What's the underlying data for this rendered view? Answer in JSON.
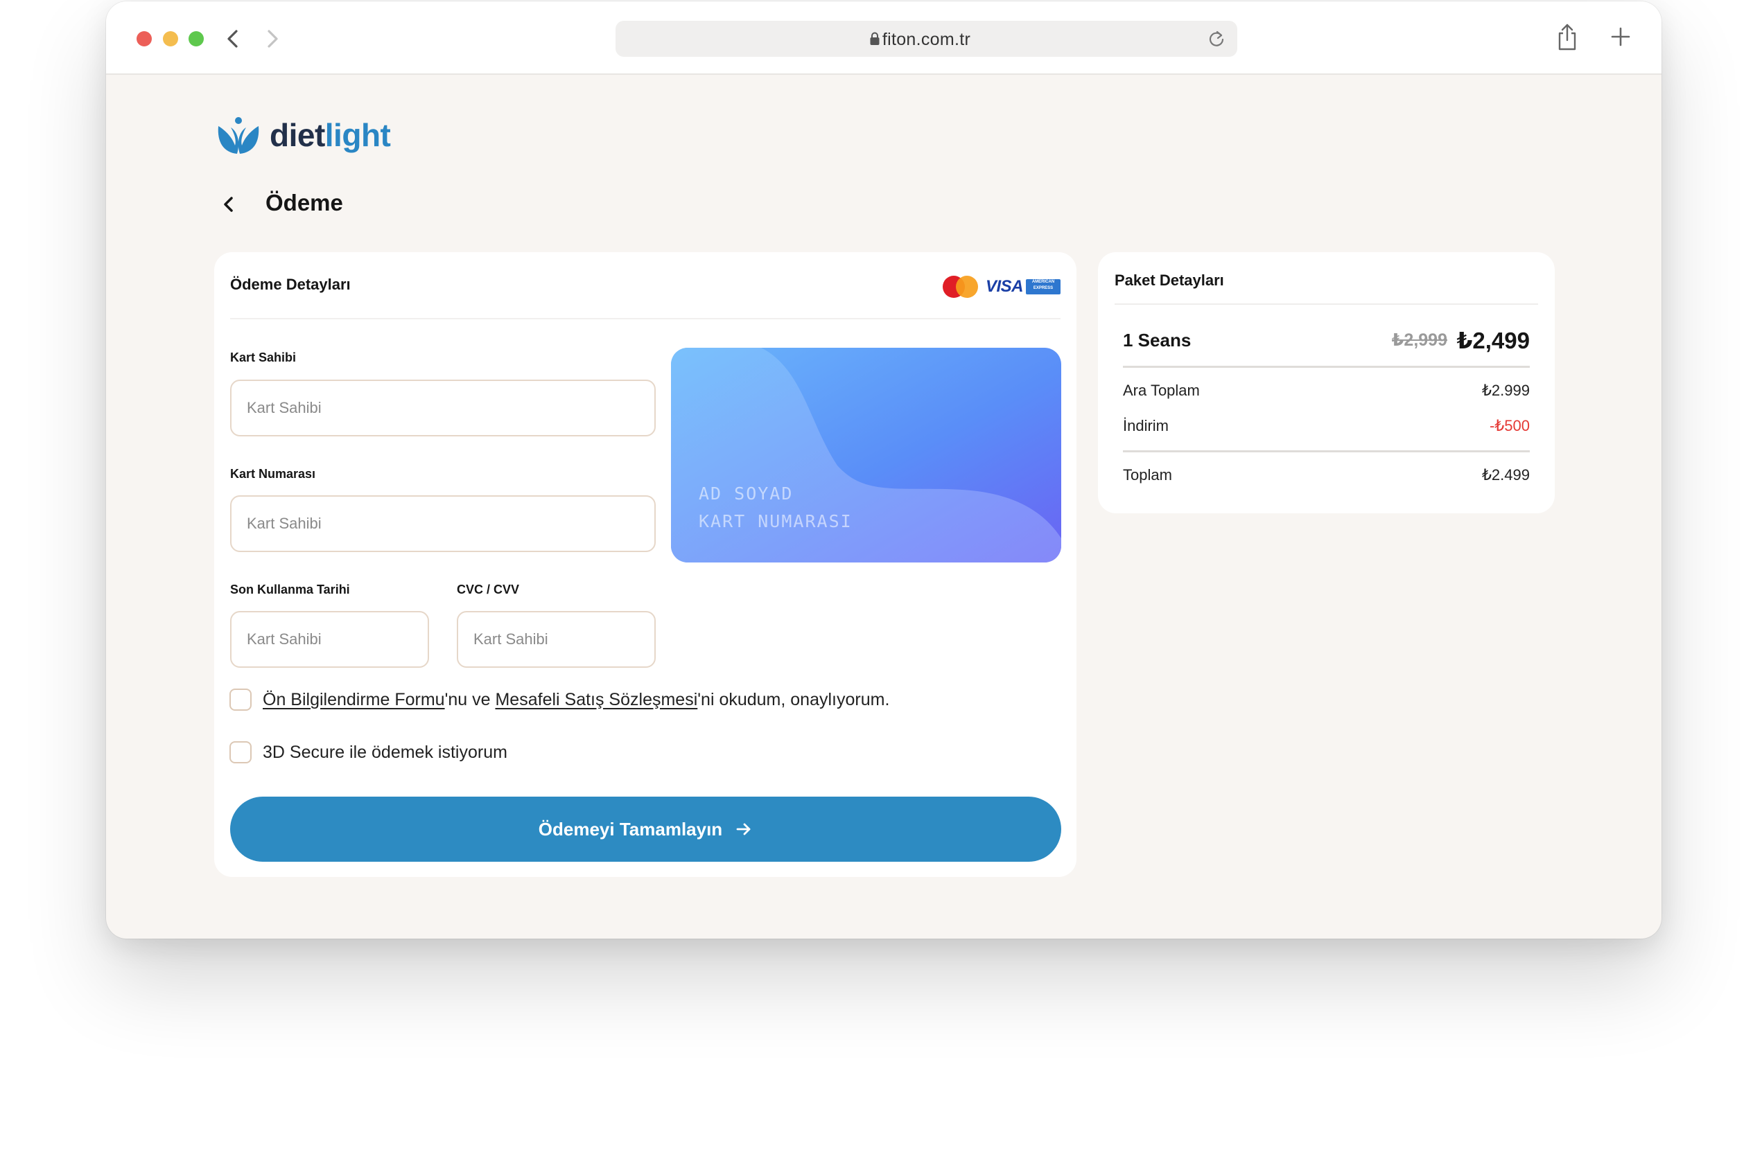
{
  "browser": {
    "url": "fiton.com.tr"
  },
  "brand": {
    "name_part1": "diet",
    "name_part2": "light",
    "accent": "#2a86c4",
    "dark": "#22304a"
  },
  "page": {
    "title": "Ödeme"
  },
  "payment": {
    "heading": "Ödeme Detayları",
    "card_brands": [
      "mastercard-icon",
      "visa-icon",
      "amex-icon"
    ],
    "visa_text": "VISA",
    "amex_text": "AMERICAN EXPRESS",
    "fields": {
      "holder_label": "Kart Sahibi",
      "holder_placeholder": "Kart Sahibi",
      "number_label": "Kart Numarası",
      "number_placeholder": "Kart Sahibi",
      "expiry_label": "Son Kullanma Tarihi",
      "expiry_placeholder": "Kart Sahibi",
      "cvc_label": "CVC / CVV",
      "cvc_placeholder": "Kart Sahibi"
    },
    "card_preview": {
      "name": "AD SOYAD",
      "number": "KART NUMARASI"
    },
    "consent": {
      "link1": "Ön Bilgilendirme Formu",
      "mid": "'nu ve ",
      "link2": "Mesafeli Satış Sözleşmesi",
      "end": "'ni okudum, onaylıyorum."
    },
    "secure_label": "3D Secure ile ödemek istiyorum",
    "submit_label": "Ödemeyi Tamamlayın",
    "button_color": "#2d8bc2"
  },
  "package": {
    "heading": "Paket Detayları",
    "item_name": "1 Seans",
    "old_price": "₺2,999",
    "new_price": "₺2,499",
    "subtotal_label": "Ara Toplam",
    "subtotal_value": "₺2.999",
    "discount_label": "İndirim",
    "discount_value": "-₺500",
    "total_label": "Toplam",
    "total_value": "₺2.499",
    "discount_color": "#e53935"
  }
}
